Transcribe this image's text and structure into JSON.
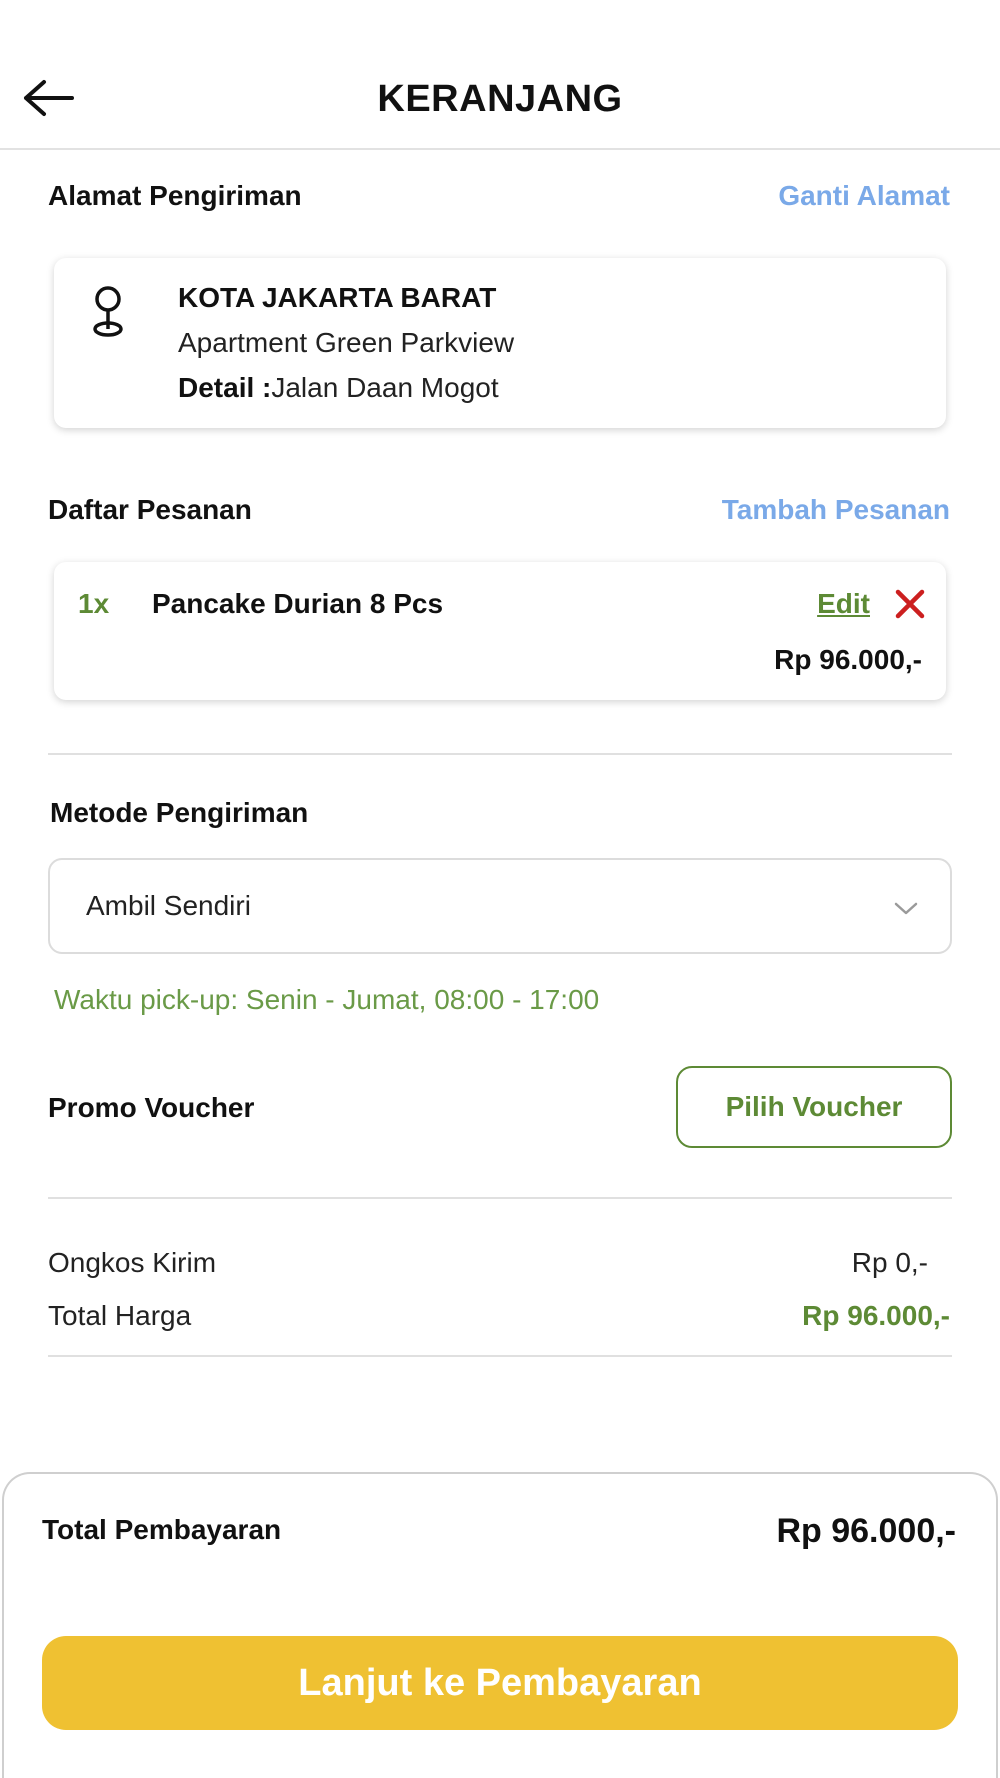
{
  "header": {
    "title": "KERANJANG",
    "back_icon": "arrow-left-icon"
  },
  "address": {
    "section_title": "Alamat Pengiriman",
    "change_link": "Ganti Alamat",
    "icon": "location-pin-icon",
    "city": "KOTA JAKARTA BARAT",
    "name": "Apartment Green Parkview",
    "detail_label": "Detail :",
    "detail_value": "Jalan Daan Mogot"
  },
  "orders": {
    "section_title": "Daftar Pesanan",
    "add_link": "Tambah Pesanan",
    "items": [
      {
        "qty": "1x",
        "name": "Pancake Durian 8 Pcs",
        "edit_label": "Edit",
        "price": "Rp 96.000,-"
      }
    ]
  },
  "shipping": {
    "section_title": "Metode Pengiriman",
    "selected": "Ambil Sendiri",
    "pickup_note": "Waktu pick-up: Senin - Jumat, 08:00 - 17:00"
  },
  "voucher": {
    "section_title": "Promo Voucher",
    "button_label": "Pilih Voucher"
  },
  "summary": {
    "shipping_label": "Ongkos Kirim",
    "shipping_value": "Rp 0,-",
    "total_label": "Total Harga",
    "total_value": "Rp 96.000,-"
  },
  "footer": {
    "total_label": "Total Pembayaran",
    "total_value": "Rp 96.000,-",
    "pay_button": "Lanjut ke Pembayaran"
  },
  "colors": {
    "accent_blue": "#7aa9e8",
    "accent_green": "#5d8a35",
    "pay_button_yellow": "#efc132",
    "remove_red": "#cc1f1f"
  }
}
